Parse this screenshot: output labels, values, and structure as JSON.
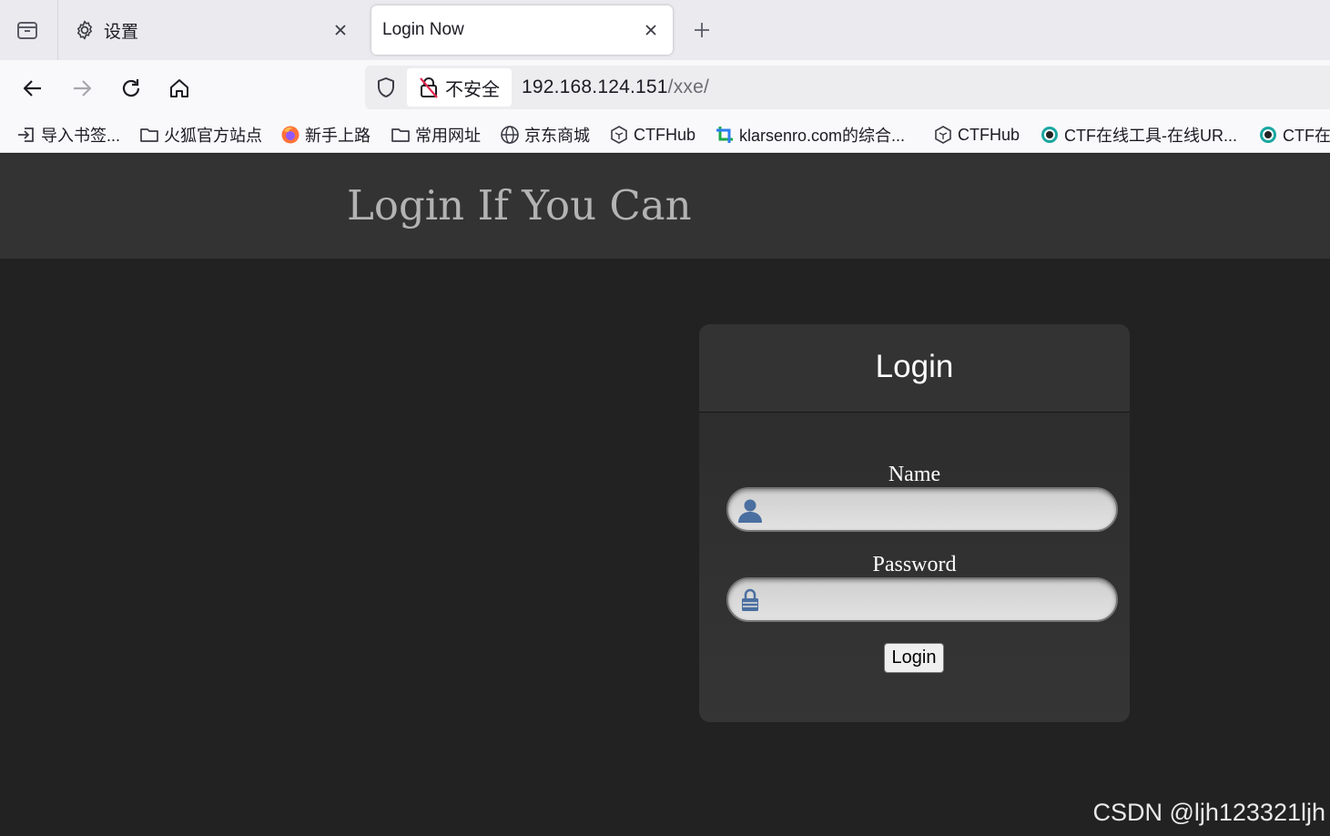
{
  "browser": {
    "tabs": [
      {
        "title": "设置",
        "icon": "gear-icon",
        "active": false
      },
      {
        "title": "Login Now",
        "icon": "",
        "active": true
      }
    ],
    "url": {
      "security_label": "不安全",
      "host": "192.168.124.151",
      "path": "/xxe/"
    },
    "bookmarks": [
      {
        "label": "导入书签...",
        "icon": "import-icon"
      },
      {
        "label": "火狐官方站点",
        "icon": "folder-icon"
      },
      {
        "label": "新手上路",
        "icon": "firefox-icon"
      },
      {
        "label": "常用网址",
        "icon": "folder-icon"
      },
      {
        "label": "京东商城",
        "icon": "globe-icon"
      },
      {
        "label": "CTFHub",
        "icon": "ctfhub-icon"
      },
      {
        "label": "klarsenro.com的综合...",
        "icon": "klarsenro-icon"
      },
      {
        "label": "CTFHub",
        "icon": "ctfhub-icon"
      },
      {
        "label": "CTF在线工具-在线UR...",
        "icon": "ctf-tool-icon"
      },
      {
        "label": "CTF在",
        "icon": "ctf-tool-icon"
      }
    ]
  },
  "page": {
    "header_title": "Login If You Can",
    "card_title": "Login",
    "name_label": "Name",
    "password_label": "Password",
    "login_button": "Login"
  },
  "watermark": "CSDN @ljh123321ljh",
  "colors": {
    "page_bg": "#222222",
    "header_bg": "#333333",
    "title_color": "#b3b3b3",
    "icon_blue": "#4a6fa0"
  }
}
